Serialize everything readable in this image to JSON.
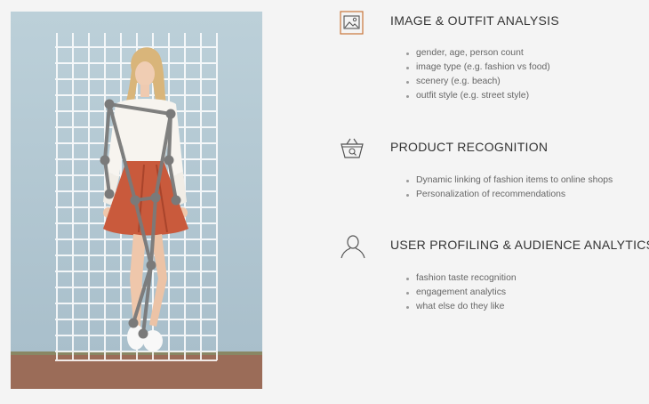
{
  "photo": {
    "alt_icon": "fashion-model-photo"
  },
  "sections": [
    {
      "icon": "image-icon",
      "title": "IMAGE & OUTFIT ANALYSIS",
      "items": [
        "gender, age, person count",
        "image type (e.g. fashion vs food)",
        "scenery (e.g. beach)",
        "outfit style (e.g. street style)"
      ]
    },
    {
      "icon": "shopping-basket-icon",
      "title": "PRODUCT RECOGNITION",
      "items": [
        "Dynamic linking of fashion items to online shops",
        "Personalization of recommendations"
      ]
    },
    {
      "icon": "user-icon",
      "title": "USER PROFILING & AUDIENCE ANALYTICS",
      "items": [
        "fashion taste recognition",
        "engagement analytics",
        "what else do they like"
      ]
    }
  ],
  "colors": {
    "accent_icon": "#c8763a",
    "wall": "#b7cbd5",
    "ground": "#9c6d5a",
    "skirt": "#c95a3c",
    "skeleton": "#7a7a7a"
  }
}
